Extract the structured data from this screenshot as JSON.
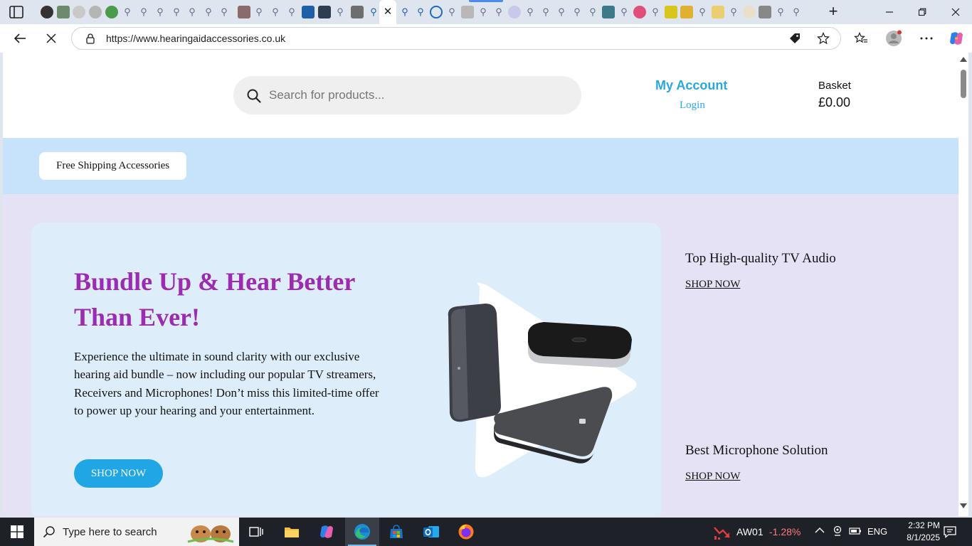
{
  "browser": {
    "url": "https://www.hearingaidaccessories.co.uk",
    "active_tab_close": "✕"
  },
  "header": {
    "search_placeholder": "Search for products...",
    "account_title": "My Account",
    "account_login": "Login",
    "basket_label": "Basket",
    "basket_amount": "£0.00"
  },
  "categories": {
    "pill": "Free Shipping Accessories"
  },
  "hero": {
    "title": "Bundle Up & Hear Better Than Ever!",
    "body": "Experience the ultimate in sound clarity with our exclusive hearing aid bundle – now including our popular TV streamers, Receivers and Microphones! Don’t miss this limited-time offer to power up your hearing and your entertainment.",
    "cta": "SHOP NOW"
  },
  "promos": [
    {
      "title": "Top High-quality TV Audio",
      "link": "SHOP NOW"
    },
    {
      "title": "Best Microphone Solution",
      "link": "SHOP NOW"
    }
  ],
  "taskbar": {
    "search_placeholder": "Type here to search",
    "stock_name": "AW01",
    "stock_change": "-1.28%",
    "language": "ENG",
    "time": "2:32 PM",
    "date": "8/1/2025"
  },
  "colors": {
    "accent_blue": "#29a8e0",
    "hero_title_purple": "#9b2bb0",
    "category_band": "#c7e3fb",
    "main_background": "#e4e2f4",
    "hero_background": "#ddeefa"
  }
}
